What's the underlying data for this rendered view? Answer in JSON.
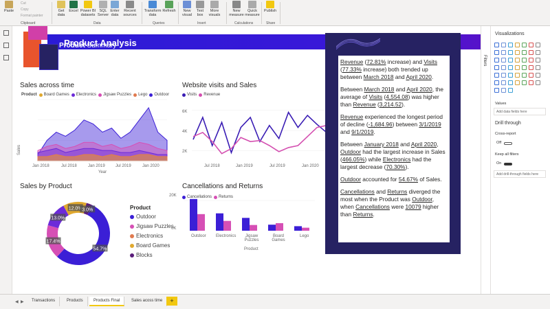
{
  "ribbon": {
    "clipboard": {
      "paste": "Paste",
      "cut": "Cut",
      "copy": "Copy",
      "format_painter": "Format painter",
      "group": "Clipboard"
    },
    "data": {
      "get_data": "Get data",
      "excel": "Excel",
      "pbi_datasets": "Power BI datasets",
      "sql": "SQL Server",
      "enter_data": "Enter data",
      "recent": "Recent sources",
      "group": "Data"
    },
    "queries": {
      "transform": "Transform data",
      "refresh": "Refresh",
      "group": "Queries"
    },
    "insert": {
      "new_visual": "New visual",
      "text_box": "Text box",
      "more_visuals": "More visuals",
      "group": "Insert"
    },
    "calculations": {
      "new_measure": "New measure",
      "quick_measure": "Quick measure",
      "group": "Calculations"
    },
    "share": {
      "publish": "Publish",
      "group": "Share"
    }
  },
  "page_title": "Product Analysis",
  "sales_time": {
    "title": "Sales across time",
    "legend_label": "Product",
    "legend": [
      "Board Games",
      "Electronics",
      "Jigsaw Puzzles",
      "Lego",
      "Outdoor"
    ],
    "ylabel": "Sales",
    "xlabel": "Year",
    "xticks": [
      "Jan 2018",
      "Jul 2018",
      "Jan 2019",
      "Jul 2019",
      "Jan 2020"
    ]
  },
  "website": {
    "title": "Website visits and Sales",
    "legend": [
      "Visits",
      "Revenue"
    ],
    "yticks": [
      "6K",
      "4K",
      "2K"
    ],
    "xticks": [
      "Jul 2018",
      "Jan 2019",
      "Jul 2019",
      "Jan 2020"
    ]
  },
  "sales_product": {
    "title": "Sales by Product",
    "legend_title": "Product",
    "legend": [
      "Outdoor",
      "Jigsaw Puzzles",
      "Electronics",
      "Board Games",
      "Blocks"
    ],
    "labels": [
      "54.7%",
      "17.4%",
      "13.0%",
      "12.0%",
      "3.0%"
    ]
  },
  "cancellations": {
    "title": "Cancellations and Returns",
    "legend": [
      "Cancellations",
      "Returns"
    ],
    "yticks": [
      "20K",
      "0K"
    ],
    "xticks": [
      "Outdoor",
      "Electronics",
      "Jigsaw Puzzles",
      "Board Games",
      "Lego"
    ],
    "xlabel": "Product"
  },
  "summary": {
    "title_bold": "Product",
    "title_rest": " Summary",
    "p1": {
      "a": "Revenue",
      "b": " (",
      "c": "72.81%",
      "d": " increase) and ",
      "e": "Visits",
      "f": " (",
      "g": "77.33%",
      "h": " increase) both trended up between ",
      "i": "March 2018",
      "j": " and ",
      "k": "April 2020",
      "l": "."
    },
    "p2": {
      "a": "Between ",
      "b": "March 2018",
      "c": " and ",
      "d": "April 2020",
      "e": ", the average of ",
      "f": "Visits",
      "g": " (",
      "h": "4,554.08",
      "i": ") was higher than ",
      "j": "Revenue",
      "k": " (",
      "l": "3,214.52",
      "m": ")."
    },
    "p3": {
      "a": "Revenue",
      "b": " experienced the longest period of decline (",
      "c": "-1,684.96",
      "d": ") between ",
      "e": "3/1/2019",
      "f": " and ",
      "g": "9/1/2019",
      "h": "."
    },
    "p4": {
      "a": "Between ",
      "b": "January 2018",
      "c": " and ",
      "d": "April 2020",
      "e": ", ",
      "f": "Outdoor",
      "g": " had the largest increase in Sales (",
      "h": "466.05%",
      "i": ") while ",
      "j": "Electronics",
      "k": " had the largest decrease (",
      "l": "70.30%",
      "m": ")."
    },
    "p5": {
      "a": "Outdoor",
      "b": " accounted for ",
      "c": "54.67%",
      "d": " of Sales."
    },
    "p6": {
      "a": "Cancellations",
      "b": " and ",
      "c": "Returns",
      "d": " diverged the most when the Product was ",
      "e": "Outdoor",
      "f": ", when ",
      "g": "Cancellations",
      "h": " were ",
      "i": "10079",
      "j": " higher than ",
      "k": "Returns",
      "l": "."
    }
  },
  "filters_label": "Filters",
  "viz_pane": {
    "title": "Visualizations",
    "values_label": "Values",
    "add_fields": "Add data fields here",
    "drill_title": "Drill through",
    "cross_report": "Cross-report",
    "off": "Off",
    "keep_filters": "Keep all filters",
    "on": "On",
    "add_drill": "Add drill-through fields here"
  },
  "tabs": [
    "Transactions",
    "Products",
    "Products Final",
    "Sales acoss time"
  ],
  "add_tab": "+",
  "colors": {
    "outdoor": "#3b1fd6",
    "jigsaw": "#d64fb5",
    "electronics": "#6c2bd9",
    "board": "#e0a82e",
    "lego": "#e07a4f",
    "blocks": "#5a1d7a",
    "visits": "#3a1db4",
    "revenue": "#d44fb0"
  },
  "chart_data": [
    {
      "type": "area",
      "title": "Sales across time",
      "x": [
        "Jan 2018",
        "Mar 2018",
        "May 2018",
        "Jul 2018",
        "Sep 2018",
        "Nov 2018",
        "Jan 2019",
        "Mar 2019",
        "May 2019",
        "Jul 2019",
        "Sep 2019",
        "Nov 2019",
        "Jan 2020",
        "Mar 2020",
        "Apr 2020"
      ],
      "series": [
        {
          "name": "Board Games",
          "values": [
            2,
            2,
            3,
            2,
            2,
            3,
            3,
            2,
            3,
            2,
            2,
            3,
            3,
            2,
            2
          ]
        },
        {
          "name": "Electronics",
          "values": [
            4,
            5,
            6,
            4,
            5,
            6,
            6,
            5,
            5,
            4,
            4,
            5,
            4,
            3,
            3
          ]
        },
        {
          "name": "Jigsaw Puzzles",
          "values": [
            5,
            7,
            8,
            6,
            7,
            9,
            9,
            7,
            8,
            6,
            7,
            9,
            8,
            6,
            5
          ]
        },
        {
          "name": "Lego",
          "values": [
            2,
            2,
            3,
            2,
            2,
            3,
            3,
            2,
            3,
            2,
            2,
            3,
            3,
            2,
            2
          ]
        },
        {
          "name": "Outdoor",
          "values": [
            3,
            10,
            14,
            12,
            15,
            20,
            18,
            14,
            16,
            11,
            14,
            20,
            26,
            14,
            10
          ]
        }
      ]
    },
    {
      "type": "line",
      "title": "Website visits and Sales",
      "x": [
        "Jan 2018",
        "Mar 2018",
        "May 2018",
        "Jul 2018",
        "Sep 2018",
        "Nov 2018",
        "Jan 2019",
        "Mar 2019",
        "May 2019",
        "Jul 2019",
        "Sep 2019",
        "Nov 2019",
        "Jan 2020",
        "Mar 2020",
        "Apr 2020"
      ],
      "ylim": [
        1000,
        7000
      ],
      "series": [
        {
          "name": "Visits",
          "values": [
            3100,
            5300,
            2500,
            4800,
            1800,
            4300,
            5300,
            2900,
            4500,
            3200,
            5800,
            4300,
            5500,
            4600,
            3800
          ]
        },
        {
          "name": "Revenue",
          "values": [
            3400,
            3800,
            2900,
            1700,
            2200,
            3300,
            2900,
            3000,
            2500,
            1900,
            2300,
            2500,
            3400,
            4300,
            4500
          ]
        }
      ]
    },
    {
      "type": "pie",
      "title": "Sales by Product",
      "categories": [
        "Outdoor",
        "Jigsaw Puzzles",
        "Electronics",
        "Board Games",
        "Blocks"
      ],
      "values": [
        54.7,
        17.4,
        13.0,
        12.0,
        3.0
      ]
    },
    {
      "type": "bar",
      "title": "Cancellations and Returns",
      "categories": [
        "Outdoor",
        "Electronics",
        "Jigsaw Puzzles",
        "Board Games",
        "Lego"
      ],
      "ylim": [
        0,
        30000
      ],
      "series": [
        {
          "name": "Cancellations",
          "values": [
            21000,
            11500,
            8500,
            4000,
            3000
          ]
        },
        {
          "name": "Returns",
          "values": [
            11000,
            6500,
            3800,
            5000,
            2000
          ]
        }
      ]
    }
  ]
}
